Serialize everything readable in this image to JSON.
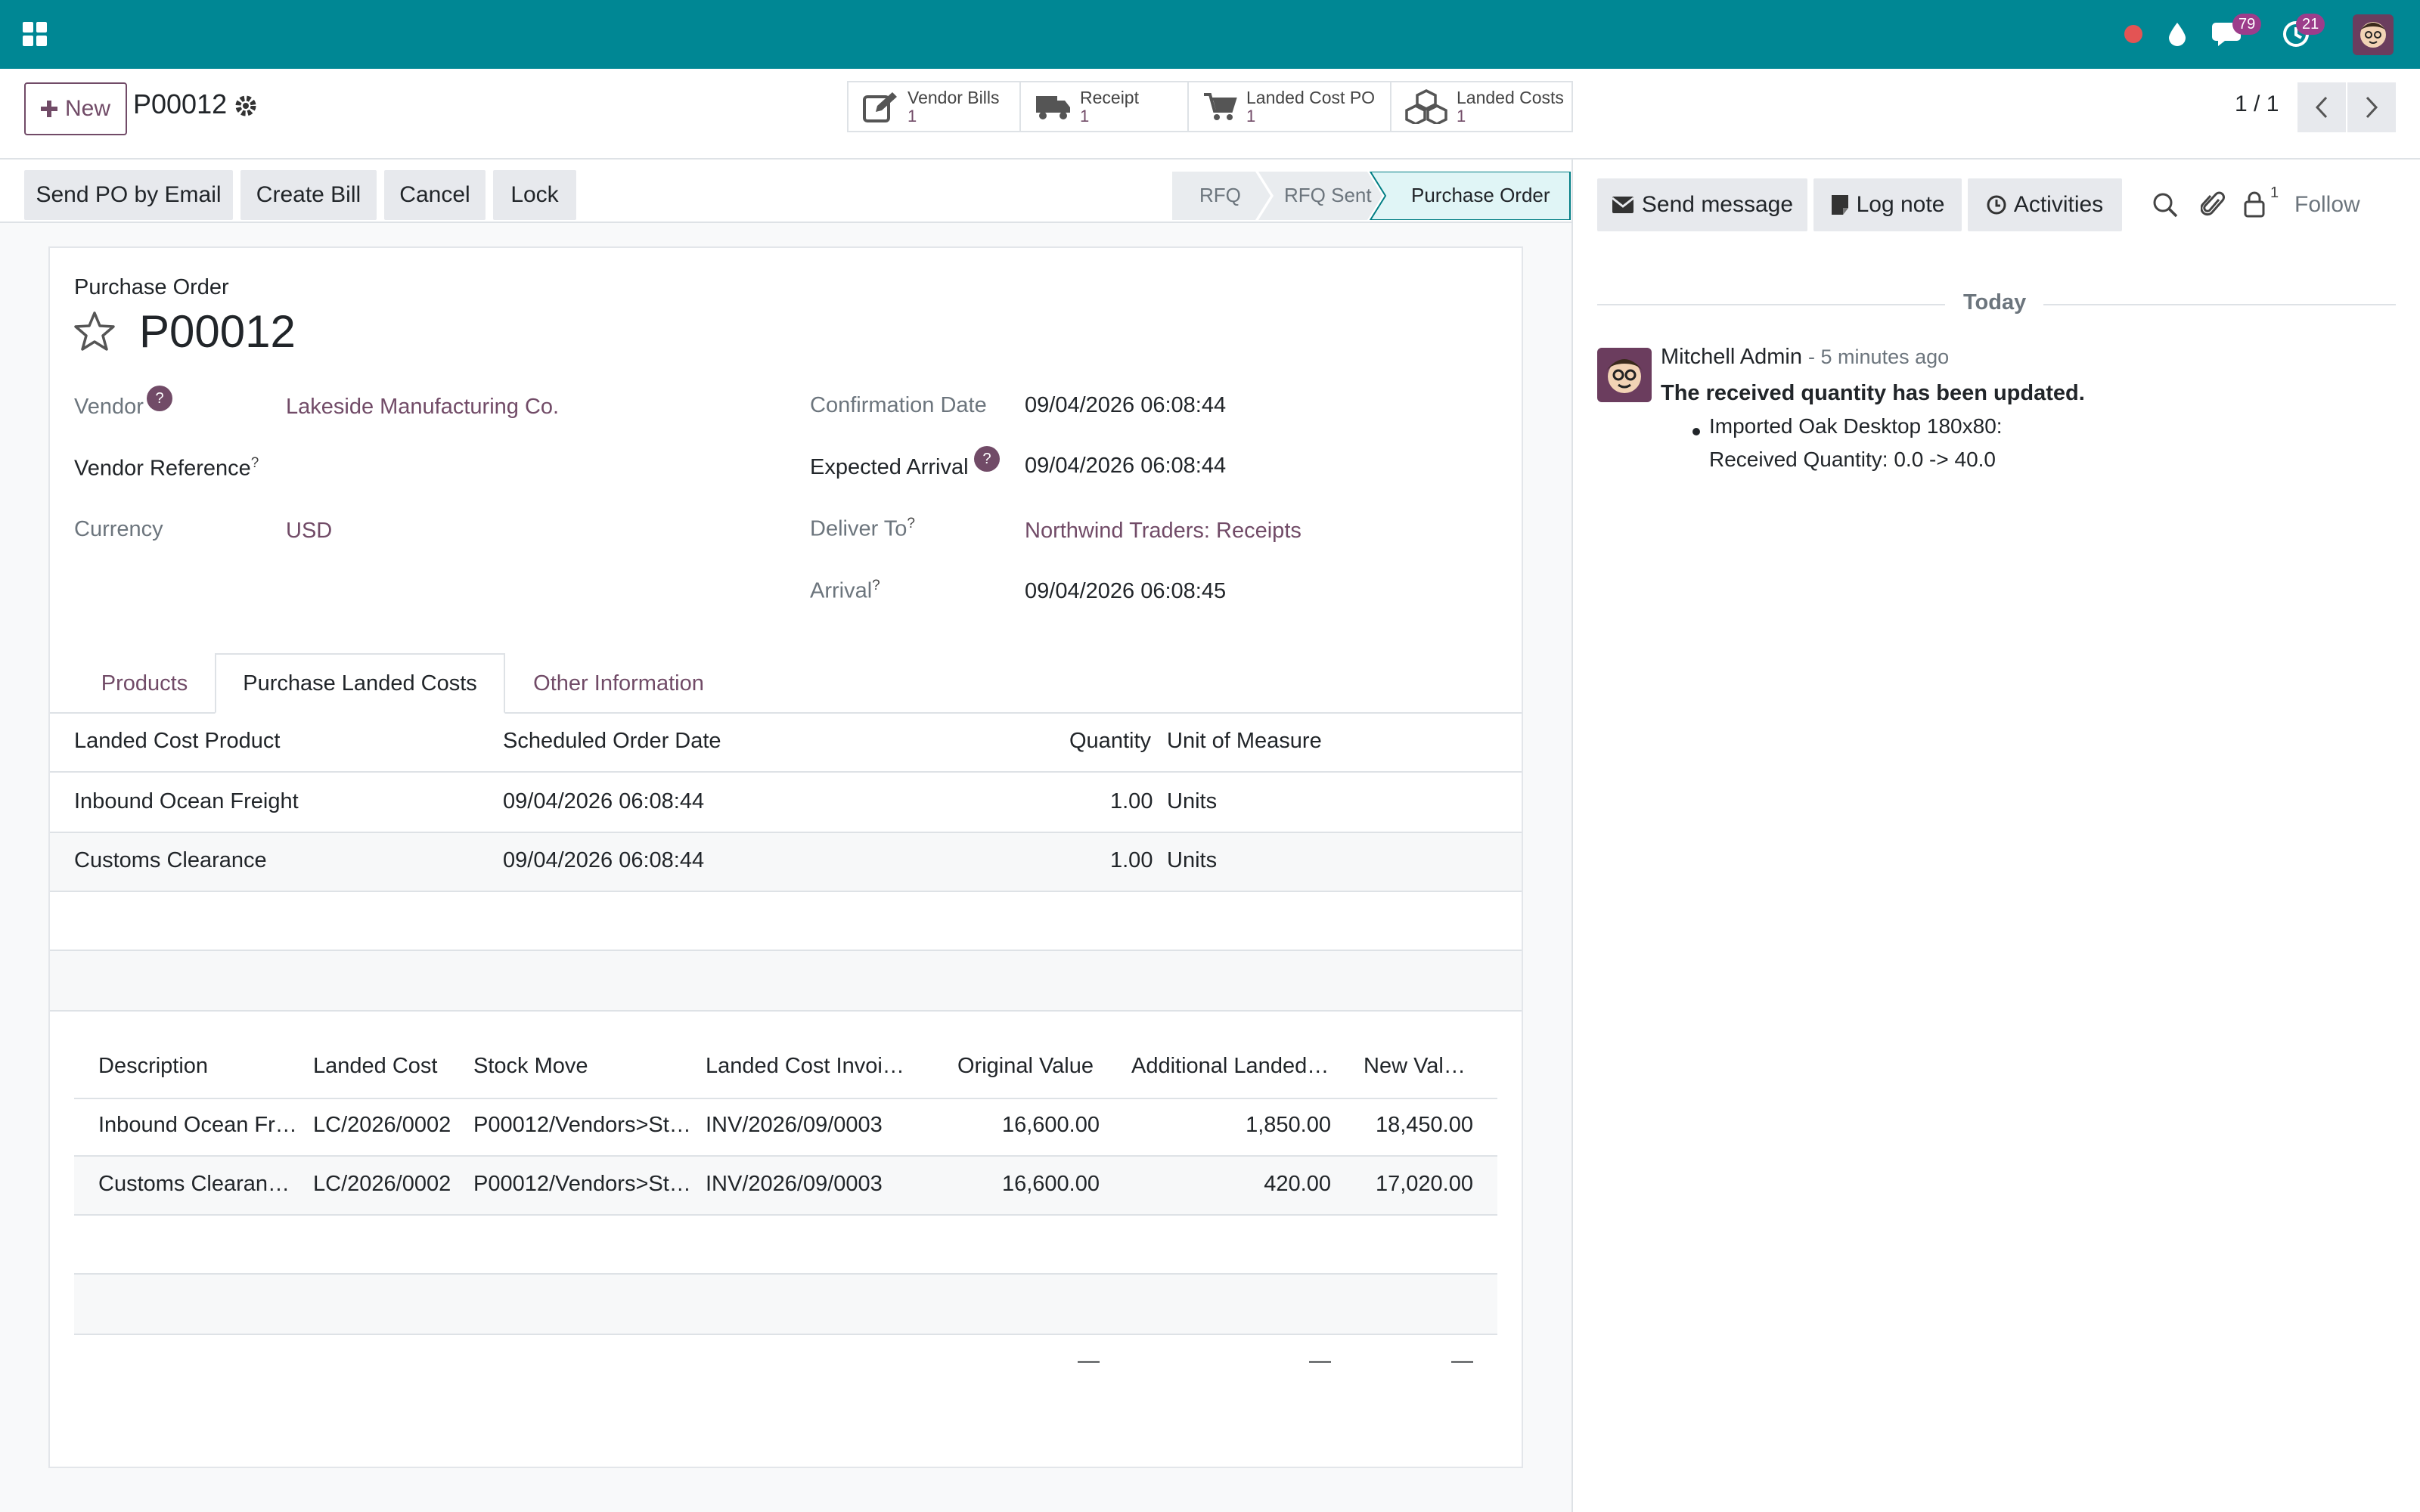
{
  "colors": {
    "navbar": "#008794",
    "brand": "#714b67",
    "badge": "#9c3d8b",
    "record_dot": "#e35454"
  },
  "navbar": {
    "apps_icon": "apps-grid-icon",
    "messages_count": "79",
    "activities_count": "21"
  },
  "control": {
    "new_label": "New",
    "record_name": "P00012",
    "pager": "1 / 1",
    "smart_buttons": [
      {
        "label": "Vendor Bills",
        "count": "1",
        "icon": "pencil-square-icon"
      },
      {
        "label": "Receipt",
        "count": "1",
        "icon": "truck-icon"
      },
      {
        "label": "Landed Cost PO",
        "count": "1",
        "icon": "cart-icon"
      },
      {
        "label": "Landed Costs",
        "count": "1",
        "icon": "cubes-icon"
      }
    ]
  },
  "actions": [
    "Send PO by Email",
    "Create Bill",
    "Cancel",
    "Lock"
  ],
  "stages": {
    "s1": "RFQ",
    "s2": "RFQ Sent",
    "s3": "Purchase Order"
  },
  "form": {
    "type_label": "Purchase Order",
    "name": "P00012",
    "vendor_label": "Vendor",
    "vendor": "Lakeside Manufacturing Co.",
    "vendor_ref_label": "Vendor Reference",
    "currency_label": "Currency",
    "currency": "USD",
    "confirmation_label": "Confirmation Date",
    "confirmation": "09/04/2026 06:08:44",
    "expected_label": "Expected Arrival",
    "expected": "09/04/2026 06:08:44",
    "deliver_label": "Deliver To",
    "deliver": "Northwind Traders: Receipts",
    "arrival_label": "Arrival",
    "arrival": "09/04/2026 06:08:45"
  },
  "tabs": {
    "products": "Products",
    "landed": "Purchase Landed Costs",
    "other": "Other Information"
  },
  "landed_table": {
    "headers": {
      "product": "Landed Cost Product",
      "date": "Scheduled Order Date",
      "qty": "Quantity",
      "uom": "Unit of Measure"
    },
    "rows": [
      {
        "product": "Inbound Ocean Freight",
        "date": "09/04/2026 06:08:44",
        "qty": "1.00",
        "uom": "Units"
      },
      {
        "product": "Customs Clearance",
        "date": "09/04/2026 06:08:44",
        "qty": "1.00",
        "uom": "Units"
      }
    ]
  },
  "valuation_table": {
    "headers": {
      "desc": "Description",
      "cost": "Landed Cost",
      "move": "Stock Move",
      "invoice": "Landed Cost Invoi…",
      "orig": "Original Value",
      "add": "Additional Landed…",
      "new": "New Val…"
    },
    "rows": [
      {
        "desc": "Inbound Ocean Fr…",
        "cost": "LC/2026/0002",
        "move": "P00012/Vendors>St…",
        "invoice": "INV/2026/09/0003",
        "orig": "16,600.00",
        "add": "1,850.00",
        "new": "18,450.00"
      },
      {
        "desc": "Customs Clearan…",
        "cost": "LC/2026/0002",
        "move": "P00012/Vendors>St…",
        "invoice": "INV/2026/09/0003",
        "orig": "16,600.00",
        "add": "420.00",
        "new": "17,020.00"
      }
    ],
    "totals": {
      "orig": "—",
      "add": "—",
      "new": "—"
    }
  },
  "chatter": {
    "send_message": "Send message",
    "log_note": "Log note",
    "activities": "Activities",
    "follow": "Follow",
    "followers_count": "1",
    "date_separator": "Today",
    "message": {
      "author": "Mitchell Admin",
      "time": "- 5 minutes ago",
      "title": "The received quantity has been updated.",
      "item_line1": "Imported Oak Desktop 180x80:",
      "item_line2": "Received Quantity: 0.0 -> 40.0"
    }
  }
}
